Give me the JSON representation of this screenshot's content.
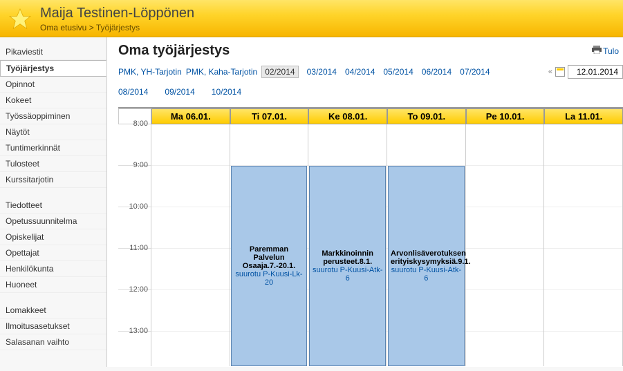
{
  "header": {
    "username": "Maija Testinen-Löppönen",
    "breadcrumb_root": "Oma etusivu",
    "breadcrumb_current": "Työjärjestys"
  },
  "print_label": "Tulo",
  "page_title": "Oma työjärjestys",
  "sidebar": {
    "items": [
      {
        "label": "Pikaviestit"
      },
      {
        "label": "Työjärjestys",
        "active": true
      },
      {
        "label": "Opinnot"
      },
      {
        "label": "Kokeet"
      },
      {
        "label": "Työssäoppiminen"
      },
      {
        "label": "Näytöt"
      },
      {
        "label": "Tuntimerkinnät"
      },
      {
        "label": "Tulosteet"
      },
      {
        "label": "Kurssitarjotin"
      }
    ],
    "group2": [
      {
        "label": "Tiedotteet"
      },
      {
        "label": "Opetussuunnitelma"
      },
      {
        "label": "Opiskelijat"
      },
      {
        "label": "Opettajat"
      },
      {
        "label": "Henkilökunta"
      },
      {
        "label": "Huoneet"
      }
    ],
    "group3": [
      {
        "label": "Lomakkeet"
      },
      {
        "label": "Ilmoitusasetukset"
      },
      {
        "label": "Salasanan vaihto"
      }
    ]
  },
  "nav": {
    "pmk_yh": "PMK, YH-Tarjotin",
    "pmk_kaha": "PMK, Kaha-Tarjotin",
    "months": [
      "02/2014",
      "03/2014",
      "04/2014",
      "05/2014",
      "06/2014",
      "07/2014",
      "08/2014",
      "09/2014",
      "10/2014"
    ],
    "current_month_index": 0,
    "prev_label": "«",
    "date_value": "12.01.2014"
  },
  "calendar": {
    "days": [
      "Ma 06.01.",
      "Ti 07.01.",
      "Ke 08.01.",
      "To 09.01.",
      "Pe 10.01.",
      "La 11.01."
    ],
    "hours": [
      "8:00",
      "9:00",
      "10:00",
      "11:00",
      "12:00",
      "13:00"
    ],
    "events": [
      {
        "day": 1,
        "title": "Paremman Palvelun Osaaja.7.-20.1.",
        "room": "suurotu P-Kuusi-Lk-20"
      },
      {
        "day": 2,
        "title": "Markkinoinnin perusteet.8.1.",
        "room": "suurotu P-Kuusi-Atk-6"
      },
      {
        "day": 3,
        "title": "Arvonlisäverotuksen erityiskysymyksiä.9.1.",
        "room": "suurotu P-Kuusi-Atk-6"
      }
    ]
  }
}
